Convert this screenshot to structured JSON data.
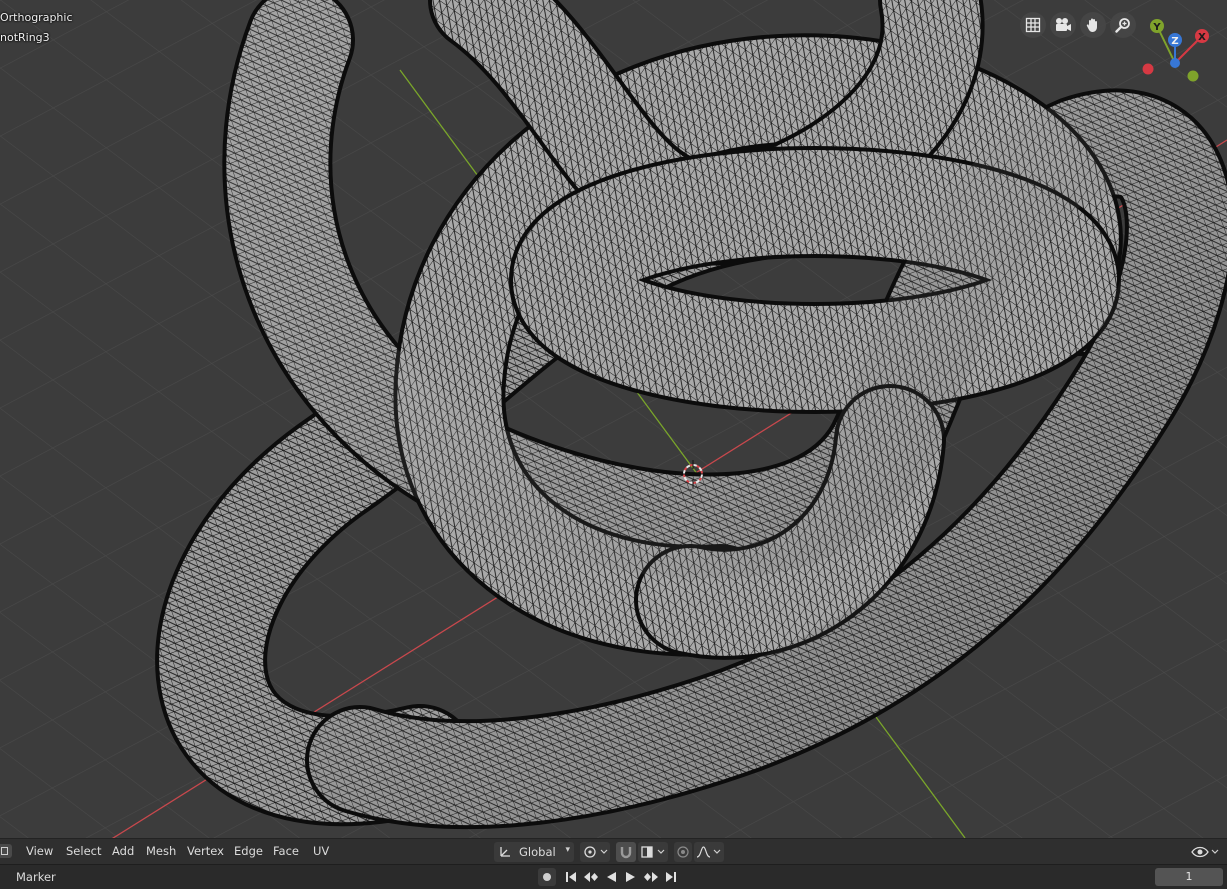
{
  "viewport": {
    "view_name": "Orthographic",
    "object_name": "notRing3"
  },
  "nav_tools": [
    {
      "name": "toggle-grid-view-icon"
    },
    {
      "name": "camera-view-icon"
    },
    {
      "name": "pan-hand-icon"
    },
    {
      "name": "zoom-icon"
    }
  ],
  "gizmo": {
    "x": "X",
    "y": "Y",
    "z": "Z"
  },
  "header": {
    "menus": [
      "View",
      "Select",
      "Add",
      "Mesh",
      "Vertex",
      "Edge",
      "Face",
      "UV"
    ],
    "transform_orientation": "Global"
  },
  "timeline": {
    "marker_label": "Marker",
    "current_frame": "1"
  },
  "colors": {
    "x_axis": "#c8484d",
    "y_axis": "#7aa62a",
    "gizmo_x": "#d63943",
    "gizmo_y": "#7fa32b",
    "gizmo_z": "#3777d6"
  }
}
